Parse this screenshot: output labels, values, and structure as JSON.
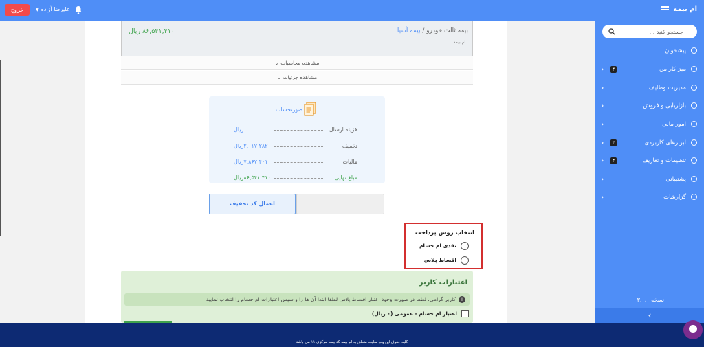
{
  "header": {
    "brand": "ام بیمه",
    "exit_label": "خروج",
    "user_name": "علیرضا آزاده"
  },
  "sidebar": {
    "search_placeholder": "جستجو کنید ...",
    "items": [
      {
        "label": "پیشخوان",
        "badge": "",
        "chevron": ""
      },
      {
        "label": "میز کار من",
        "badge": "۴",
        "chevron": "‹"
      },
      {
        "label": "مدیریت وظایف",
        "badge": "",
        "chevron": "‹"
      },
      {
        "label": "بازاریابی و فروش",
        "badge": "",
        "chevron": "‹"
      },
      {
        "label": "امور مالی",
        "badge": "",
        "chevron": "‹"
      },
      {
        "label": "ابزارهای کاربردی",
        "badge": "۴",
        "chevron": "‹"
      },
      {
        "label": "تنظیمات و تعاریف",
        "badge": "۴",
        "chevron": "‹"
      },
      {
        "label": "پشتیبانی",
        "badge": "",
        "chevron": "‹"
      },
      {
        "label": "گزارشات",
        "badge": "",
        "chevron": "‹"
      }
    ],
    "version": "نسخه ۳،۰،۰",
    "collapse_icon": "‹"
  },
  "quote": {
    "title_prefix": "بیمه ثالث خودرو",
    "separator": "/",
    "insurer": "بیمه آسیا",
    "subtitle": "ام بیمه",
    "price": "۸۶,۵۴۱,۴۱۰ ریال",
    "show_calculations": "مشاهده محاسبات",
    "show_details": "مشاهده جزئیات"
  },
  "invoice": {
    "title": "صورتحساب",
    "rows": [
      {
        "label": "هزینه ارسال",
        "value": "۰ریال"
      },
      {
        "label": "تخفیف",
        "value": "۲,۰۱۷,۲۸۲ریال"
      },
      {
        "label": "مالیات",
        "value": "۷,۸۶۷,۴۰۱ریال"
      },
      {
        "label": "مبلغ نهایی",
        "value": "۸۶,۵۴۱,۴۱۰ریال"
      }
    ]
  },
  "discount": {
    "input_value": "",
    "apply_label": "اعمال کد تخفیف"
  },
  "payment": {
    "title": "انتخاب روش پرداخت",
    "options": [
      "نقدی ام حسام",
      "اقساط پلاس"
    ]
  },
  "credit": {
    "title": "اعتبارات کاربر",
    "info": "کاربر گرامی، لطفا در صورت وجود اعتبار اقساط پلاس لطفا ابتدا آن ها را و سپس اعتبارات ام حسام را انتخاب نمایید",
    "checkbox_label": "اعتبار ام حسام - عمومی (۰ ریال)"
  },
  "footer": {
    "copyright": "کلیه حقوق این وب سایت متعلق به ام بیمه کد بیمه مرکزی ۱۱ می باشد"
  },
  "colors": {
    "primary": "#4f8ef7",
    "danger": "#f24a4a",
    "success": "#3fa34d",
    "footer": "#0d2a73"
  }
}
